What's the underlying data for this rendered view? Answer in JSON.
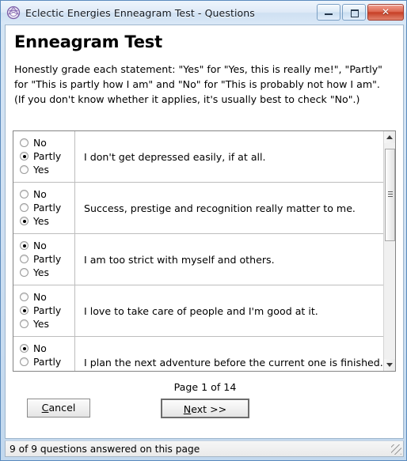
{
  "window": {
    "title": "Eclectic Energies Enneagram Test - Questions",
    "icon": "enneagram-icon",
    "controls": {
      "minimize": "minimize-icon",
      "maximize": "maximize-icon",
      "close": "✕"
    },
    "frame_color": "#cfe0f2",
    "close_color": "#c63f26"
  },
  "content": {
    "heading": "Enneagram Test",
    "instructions": "Honestly grade each statement: \"Yes\" for \"Yes, this is really me!\", \"Partly\" for \"This is partly how I am\" and \"No\" for \"This is probably not how I am\". (If you don't know whether it applies, it's usually best to check \"No\".)"
  },
  "options": [
    "No",
    "Partly",
    "Yes"
  ],
  "questions": [
    {
      "text": "I don't get depressed easily, if at all.",
      "selected": "Partly"
    },
    {
      "text": "Success, prestige and recognition really matter to me.",
      "selected": "Yes"
    },
    {
      "text": "I am too strict with myself and others.",
      "selected": "No"
    },
    {
      "text": "I love to take care of people and I'm good at it.",
      "selected": "Partly"
    },
    {
      "text": "I plan the next adventure before the current one is finished.",
      "selected": "No"
    }
  ],
  "footer": {
    "page_indicator": "Page 1 of 14",
    "cancel_label": "Cancel",
    "cancel_mnemonic": "C",
    "next_label": "Next >>",
    "next_mnemonic": "N"
  },
  "statusbar": {
    "text": "9 of 9 questions answered on this page"
  },
  "scrollbar": {
    "up_arrow": "scroll-up-icon",
    "down_arrow": "scroll-down-icon"
  }
}
